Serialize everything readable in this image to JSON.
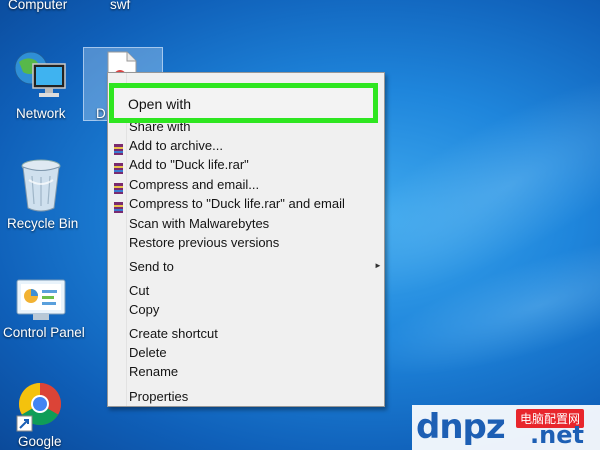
{
  "desktop": {
    "top_labels": [
      "Computer",
      "swf"
    ],
    "icons": [
      {
        "label": "Network"
      },
      {
        "label": "D"
      },
      {
        "label": "Recycle Bin"
      },
      {
        "label": "Control Panel"
      },
      {
        "label": "Google"
      }
    ]
  },
  "context_menu": {
    "highlighted": "Open with",
    "items": [
      {
        "label": "Share with"
      },
      {
        "label": "Add to archive..."
      },
      {
        "label": "Add to \"Duck life.rar\""
      },
      {
        "label": "Compress and email..."
      },
      {
        "label": "Compress to \"Duck life.rar\" and email"
      },
      {
        "label": "Scan with Malwarebytes"
      },
      {
        "label": "Restore previous versions"
      },
      {
        "label": "Send to"
      },
      {
        "label": "Cut"
      },
      {
        "label": "Copy"
      },
      {
        "label": "Create shortcut"
      },
      {
        "label": "Delete"
      },
      {
        "label": "Rename"
      },
      {
        "label": "Properties"
      }
    ]
  },
  "watermark": {
    "brand": "dnpz",
    "tld": ".net",
    "badge": "电脑配置网"
  },
  "colors": {
    "highlight_border": "#2ee620",
    "desktop_blue": "#1f86dc",
    "watermark_blue": "#1d5fb4",
    "watermark_red": "#e8262c"
  }
}
